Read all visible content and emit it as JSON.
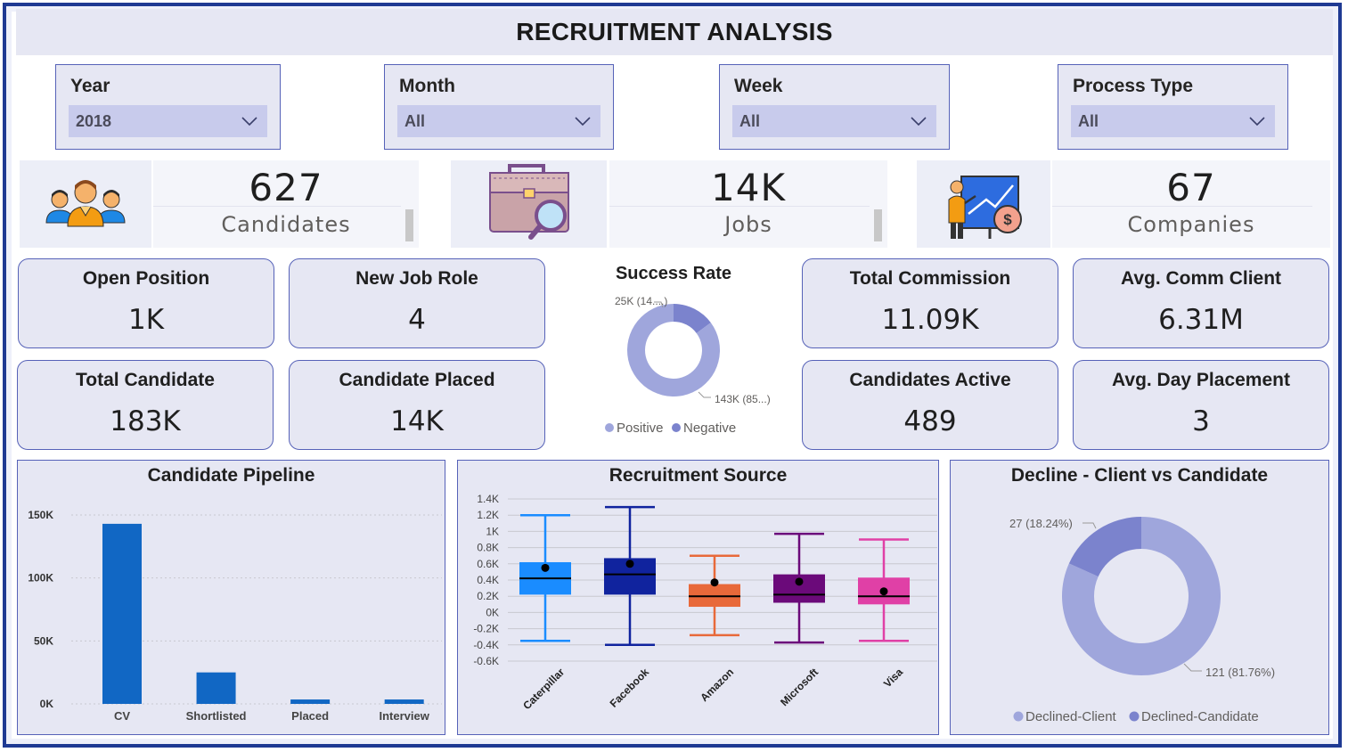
{
  "title": "RECRUITMENT ANALYSIS",
  "slicers": [
    {
      "label": "Year",
      "value": "2018"
    },
    {
      "label": "Month",
      "value": "All"
    },
    {
      "label": "Week",
      "value": "All"
    },
    {
      "label": "Process Type",
      "value": "All"
    }
  ],
  "kpis": [
    {
      "value": "627",
      "label": "Candidates",
      "icon": "people-group-icon"
    },
    {
      "value": "14K",
      "label": "Jobs",
      "icon": "briefcase-search-icon"
    },
    {
      "value": "67",
      "label": "Companies",
      "icon": "presenter-dollar-icon"
    }
  ],
  "cards": {
    "open_position": {
      "title": "Open Position",
      "value": "1K"
    },
    "new_job_role": {
      "title": "New Job Role",
      "value": "4"
    },
    "total_candidate": {
      "title": "Total Candidate",
      "value": "183K"
    },
    "candidate_placed": {
      "title": "Candidate Placed",
      "value": "14K"
    },
    "total_commission": {
      "title": "Total Commission",
      "value": "11.09K"
    },
    "avg_comm_client": {
      "title": "Avg. Comm Client",
      "value": "6.31M"
    },
    "candidates_active": {
      "title": "Candidates Active",
      "value": "489"
    },
    "avg_day_placement": {
      "title": "Avg. Day Placement",
      "value": "3"
    }
  },
  "colors": {
    "donut_light": "#9fa6dc",
    "donut_dark": "#7b83cd",
    "bar": "#1167c4",
    "panel_bg": "#e6e7f3",
    "border": "#5662b8"
  },
  "chart_data": [
    {
      "type": "pie",
      "title": "Success Rate",
      "labels": [
        "Positive",
        "Negative"
      ],
      "values": [
        143000,
        25000
      ],
      "data_labels": [
        "143K (85...)",
        "25K (14....)"
      ],
      "legend": "bottom"
    },
    {
      "type": "bar",
      "title": "Candidate Pipeline",
      "categories": [
        "CV",
        "Shortlisted",
        "Placed",
        "Interview"
      ],
      "values": [
        143000,
        25000,
        3500,
        3500
      ],
      "ylim": [
        0,
        150000
      ],
      "yticks": [
        "0K",
        "50K",
        "100K",
        "150K"
      ],
      "grid": true
    },
    {
      "type": "box",
      "title": "Recruitment Source",
      "categories": [
        "Caterpillar",
        "Facebook",
        "Amazon",
        "Microsoft",
        "Visa"
      ],
      "colors": [
        "#1a8cff",
        "#10239e",
        "#e8693a",
        "#6b0a7a",
        "#e040a6"
      ],
      "series": [
        {
          "name": "Caterpillar",
          "min": -0.35,
          "q1": 0.22,
          "median": 0.42,
          "q3": 0.62,
          "max": 1.2,
          "mean": 0.55
        },
        {
          "name": "Facebook",
          "min": -0.4,
          "q1": 0.22,
          "median": 0.47,
          "q3": 0.67,
          "max": 1.3,
          "mean": 0.6
        },
        {
          "name": "Amazon",
          "min": -0.28,
          "q1": 0.07,
          "median": 0.2,
          "q3": 0.35,
          "max": 0.7,
          "mean": 0.37
        },
        {
          "name": "Microsoft",
          "min": -0.37,
          "q1": 0.12,
          "median": 0.22,
          "q3": 0.47,
          "max": 0.97,
          "mean": 0.38
        },
        {
          "name": "Visa",
          "min": -0.35,
          "q1": 0.1,
          "median": 0.2,
          "q3": 0.43,
          "max": 0.9,
          "mean": 0.26
        }
      ],
      "ylim": [
        -0.6,
        1.4
      ],
      "yticks": [
        "-0.6K",
        "-0.4K",
        "-0.2K",
        "0K",
        "0.2K",
        "0.4K",
        "0.6K",
        "0.8K",
        "1K",
        "1.2K",
        "1.4K"
      ]
    },
    {
      "type": "pie",
      "title": "Decline - Client vs Candidate",
      "labels": [
        "Declined-Client",
        "Declined-Candidate"
      ],
      "values": [
        121,
        27
      ],
      "data_labels": [
        "121 (81.76%)",
        "27 (18.24%)"
      ],
      "legend": "bottom"
    }
  ]
}
